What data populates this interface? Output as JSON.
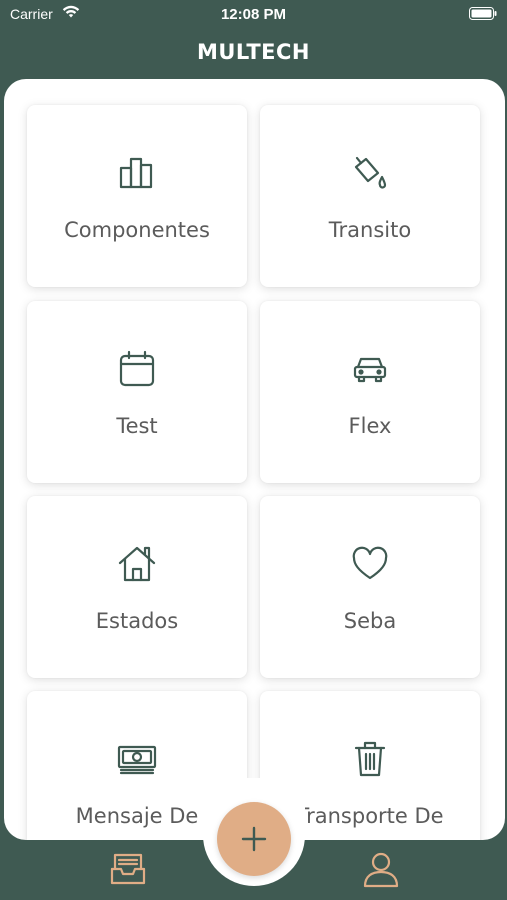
{
  "status_bar": {
    "carrier": "Carrier",
    "time": "12:08 PM"
  },
  "header": {
    "title": "MULTECH"
  },
  "colors": {
    "primary": "#3f5a52",
    "accent": "#e0ad86",
    "card_text": "#5b5b5b",
    "icon": "#3f5a52"
  },
  "cards": [
    {
      "label": "Componentes",
      "icon": "bar-chart-icon"
    },
    {
      "label": "Transito",
      "icon": "paint-bucket-icon"
    },
    {
      "label": "Test",
      "icon": "calendar-icon"
    },
    {
      "label": "Flex",
      "icon": "car-icon"
    },
    {
      "label": "Estados",
      "icon": "home-icon"
    },
    {
      "label": "Seba",
      "icon": "heart-icon"
    },
    {
      "label": "Mensaje De Conversacion",
      "label_visible": "Mensaje De",
      "icon": "money-icon"
    },
    {
      "label": "Transporte De Metal",
      "label_visible": "Transporte De",
      "icon": "trash-icon"
    }
  ],
  "tab_bar": {
    "items": [
      {
        "icon": "inbox-icon"
      },
      {
        "icon": "add-icon"
      },
      {
        "icon": "profile-icon"
      }
    ]
  }
}
